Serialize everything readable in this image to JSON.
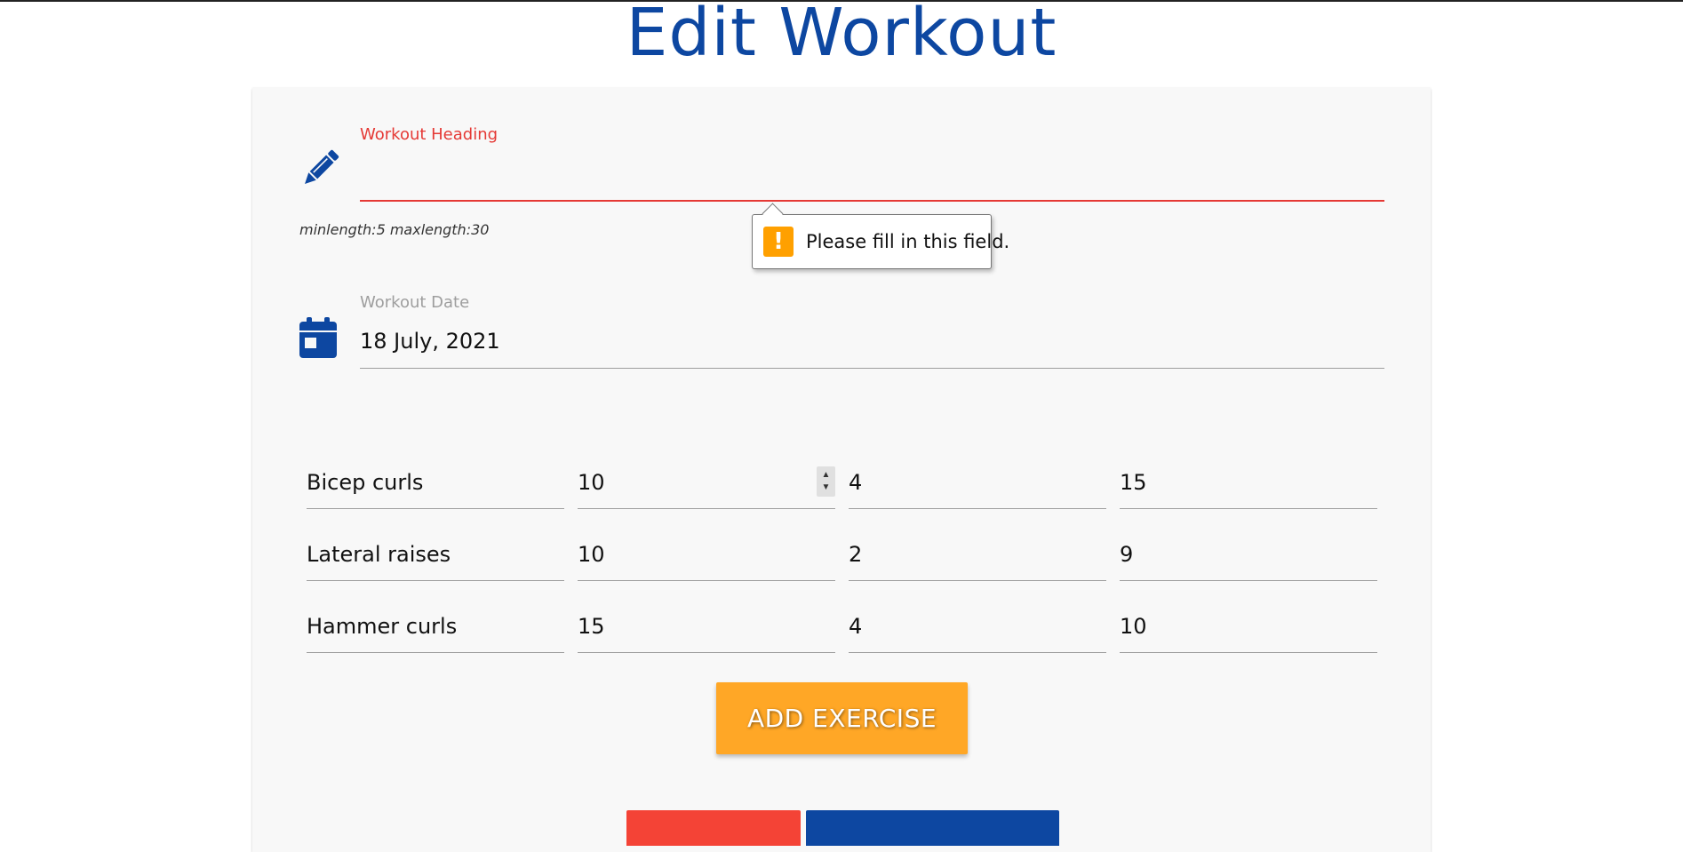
{
  "page": {
    "title": "Edit Workout"
  },
  "form": {
    "heading": {
      "label": "Workout Heading",
      "value": "",
      "hint": "minlength:5 maxlength:30",
      "icon": "pencil-icon"
    },
    "validation": {
      "message": "Please fill in this field.",
      "icon": "warning-icon",
      "badge": "!"
    },
    "date": {
      "label": "Workout Date",
      "value": "18 July, 2021",
      "icon": "calendar-icon"
    },
    "exercises": [
      {
        "name": "Bicep curls",
        "reps": "10",
        "sets": "4",
        "weight": "15"
      },
      {
        "name": "Lateral raises",
        "reps": "10",
        "sets": "2",
        "weight": "9"
      },
      {
        "name": "Hammer curls",
        "reps": "15",
        "sets": "4",
        "weight": "10"
      }
    ],
    "add_exercise_label": "ADD EXERCISE"
  },
  "colors": {
    "primary": "#0d47a1",
    "error": "#e53935",
    "accent": "#ffa726",
    "danger": "#f44336"
  }
}
